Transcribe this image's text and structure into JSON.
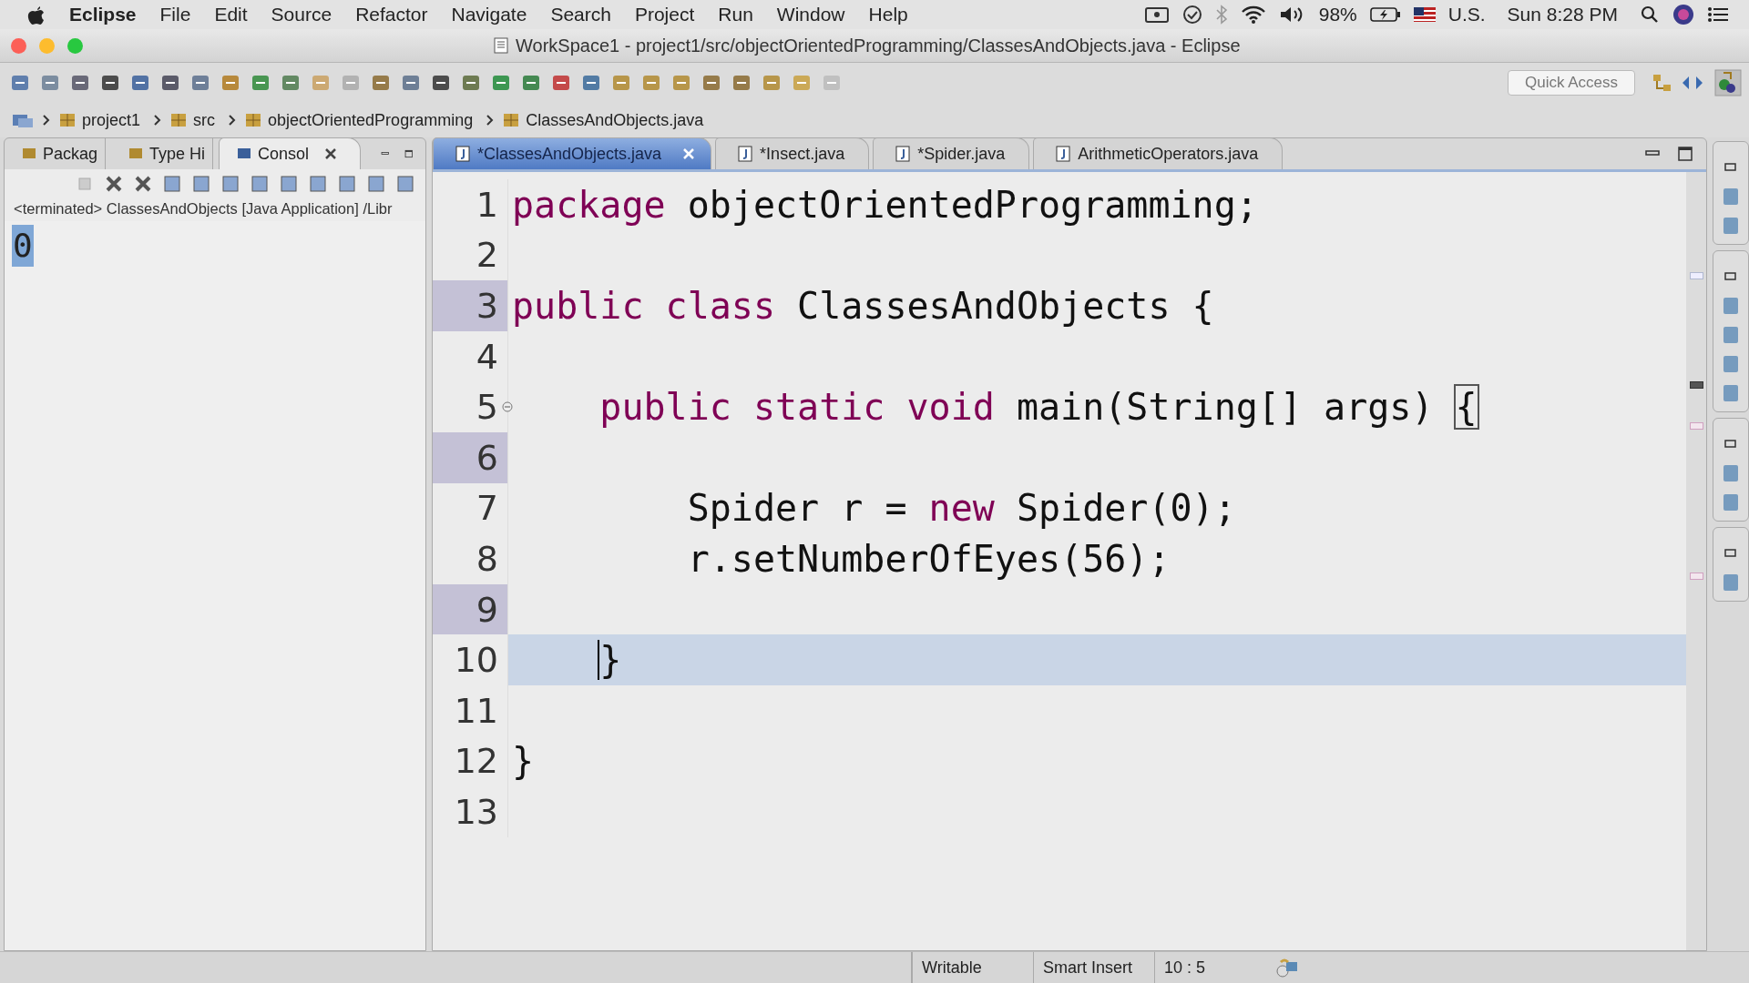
{
  "menu_bar": {
    "app": "Eclipse",
    "items": [
      "File",
      "Edit",
      "Source",
      "Refactor",
      "Navigate",
      "Search",
      "Project",
      "Run",
      "Window",
      "Help"
    ],
    "battery": "98%",
    "input_source": "U.S.",
    "clock": "Sun 8:28 PM"
  },
  "window": {
    "title": "WorkSpace1 - project1/src/objectOrientedProgramming/ClassesAndObjects.java - Eclipse"
  },
  "quick_access": {
    "placeholder": "Quick Access"
  },
  "breadcrumb": [
    "project1",
    "src",
    "objectOrientedProgramming",
    "ClassesAndObjects.java"
  ],
  "left_panel": {
    "tabs": [
      {
        "label": "Packag",
        "selected": false
      },
      {
        "label": "Type Hi",
        "selected": false
      },
      {
        "label": "Consol",
        "selected": true
      }
    ],
    "console": {
      "header": "<terminated> ClassesAndObjects [Java Application] /Libr",
      "output": "0",
      "selected": true
    }
  },
  "editor": {
    "tabs": [
      {
        "label": "*ClassesAndObjects.java",
        "selected": true
      },
      {
        "label": "*Insect.java",
        "selected": false
      },
      {
        "label": "*Spider.java",
        "selected": false
      },
      {
        "label": "ArithmeticOperators.java",
        "selected": false
      }
    ],
    "lines": [
      {
        "number": "1",
        "marked": false,
        "current": false,
        "foldable": false,
        "tokens": [
          {
            "kind": "keyword",
            "text": "package"
          },
          {
            "kind": "plain",
            "text": " objectOrientedProgramming;"
          }
        ]
      },
      {
        "number": "2",
        "marked": false,
        "current": false,
        "foldable": false
      },
      {
        "number": "3",
        "marked": true,
        "current": false,
        "foldable": false,
        "tokens": [
          {
            "kind": "keyword",
            "text": "public"
          },
          {
            "kind": "keyword",
            "text": " class"
          },
          {
            "kind": "plain",
            "text": " ClassesAndObjects {"
          }
        ]
      },
      {
        "number": "4",
        "marked": false,
        "current": false,
        "foldable": false
      },
      {
        "number": "5",
        "marked": false,
        "current": false,
        "foldable": true,
        "tokens": [
          {
            "kind": "keyword",
            "text": "    public"
          },
          {
            "kind": "keyword",
            "text": " static"
          },
          {
            "kind": "keyword",
            "text": " void"
          },
          {
            "kind": "plain",
            "text": " main(String[] args) "
          },
          {
            "kind": "bracket",
            "text": "{"
          }
        ]
      },
      {
        "number": "6",
        "marked": true,
        "current": false,
        "foldable": false
      },
      {
        "number": "7",
        "marked": false,
        "current": false,
        "foldable": false,
        "tokens": [
          {
            "kind": "plain",
            "text": "        Spider r = "
          },
          {
            "kind": "keyword",
            "text": "new"
          },
          {
            "kind": "plain",
            "text": " Spider(0);"
          }
        ]
      },
      {
        "number": "8",
        "marked": false,
        "current": false,
        "foldable": false,
        "tokens": [
          {
            "kind": "plain",
            "text": "        r.setNumberOfEyes(56);"
          }
        ]
      },
      {
        "number": "9",
        "marked": true,
        "current": false,
        "foldable": false
      },
      {
        "number": "10",
        "marked": false,
        "current": true,
        "foldable": false,
        "caret": true,
        "tokens": [
          {
            "kind": "plain",
            "text": "    }"
          }
        ]
      },
      {
        "number": "11",
        "marked": false,
        "current": false,
        "foldable": false
      },
      {
        "number": "12",
        "marked": false,
        "current": false,
        "foldable": false,
        "tokens": [
          {
            "kind": "plain",
            "text": "}"
          }
        ]
      },
      {
        "number": "13",
        "marked": false,
        "current": false,
        "foldable": false
      }
    ]
  },
  "status_bar": [
    "Writable",
    "Smart Insert",
    "10 : 5"
  ]
}
